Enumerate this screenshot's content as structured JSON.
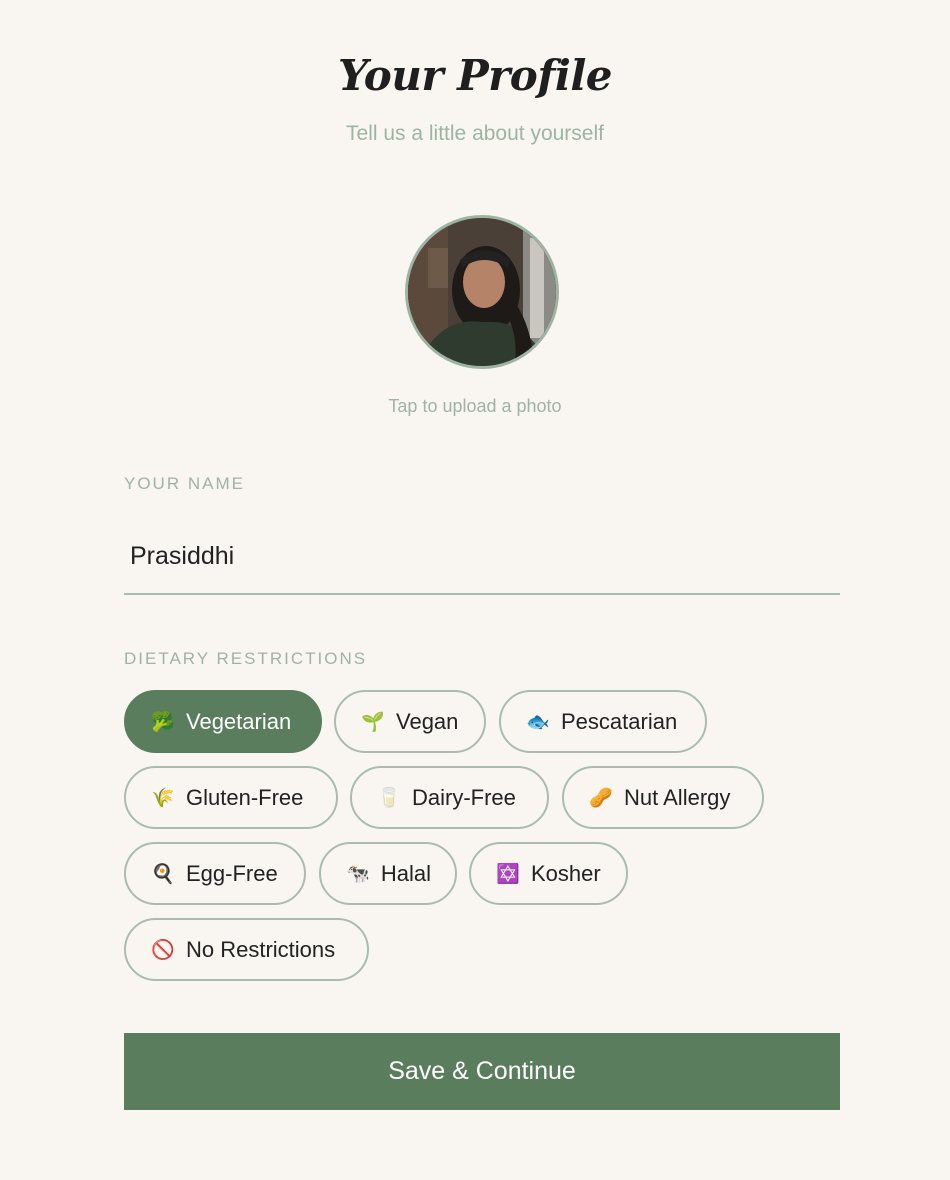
{
  "header": {
    "title": "Your Profile",
    "subtitle": "Tell us a little about yourself"
  },
  "photo": {
    "upload_hint": "Tap to upload a photo"
  },
  "name": {
    "label": "YOUR NAME",
    "value": "Prasiddhi"
  },
  "dietary": {
    "label": "DIETARY RESTRICTIONS",
    "options": [
      {
        "emoji": "🥦",
        "label": "Vegetarian",
        "selected": true
      },
      {
        "emoji": "🌱",
        "label": "Vegan",
        "selected": false
      },
      {
        "emoji": "🐟",
        "label": "Pescatarian",
        "selected": false
      },
      {
        "emoji": "🌾",
        "label": "Gluten-Free",
        "selected": false
      },
      {
        "emoji": "🥛",
        "label": "Dairy-Free",
        "selected": false
      },
      {
        "emoji": "🥜",
        "label": "Nut Allergy",
        "selected": false
      },
      {
        "emoji": "🍳",
        "label": "Egg-Free",
        "selected": false
      },
      {
        "emoji": "🐄",
        "label": "Halal",
        "selected": false
      },
      {
        "emoji": "✡️",
        "label": "Kosher",
        "selected": false
      },
      {
        "emoji": "🚫",
        "label": "No Restrictions",
        "selected": false
      }
    ]
  },
  "actions": {
    "save_label": "Save & Continue"
  },
  "colors": {
    "accent": "#5a7d5d",
    "muted": "#9db4a3",
    "background": "#f9f6f1"
  }
}
